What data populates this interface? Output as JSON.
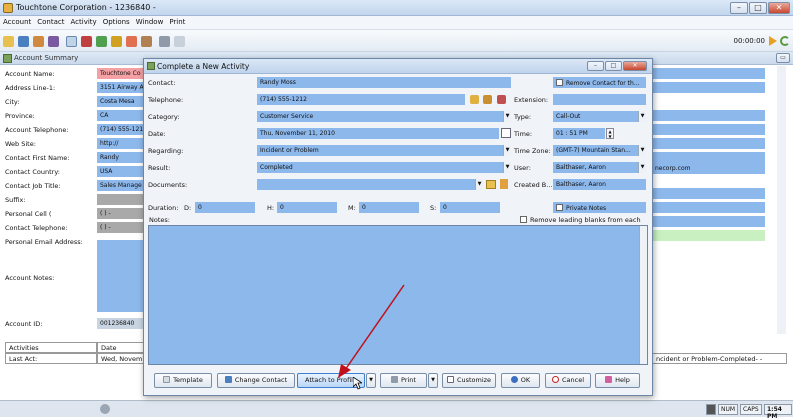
{
  "window": {
    "title": "Touchtone Corporation - 1236840 -"
  },
  "menu": [
    "Account",
    "Contact",
    "Activity",
    "Options",
    "Window",
    "Print"
  ],
  "toolbar": {
    "timer": "00:00:00"
  },
  "summary": {
    "title": "Account Summary",
    "fields": [
      {
        "label": "Account Name:",
        "value": "Touchtone Co"
      },
      {
        "label": "Address Line-1:",
        "value": "3151 Airway A"
      },
      {
        "label": "City:",
        "value": "Costa Mesa"
      },
      {
        "label": "Province:",
        "value": "CA"
      },
      {
        "label": "Account Telephone:",
        "value": "(714) 555-121"
      },
      {
        "label": "Web Site:",
        "value": "http://"
      },
      {
        "label": "Contact First Name:",
        "value": "Randy"
      },
      {
        "label": "Contact Country:",
        "value": "USA"
      },
      {
        "label": "Contact Job Title:",
        "value": "Sales Manage"
      },
      {
        "label": "Suffix:",
        "value": ""
      },
      {
        "label": "Personal Cell (",
        "value": "(  )  -"
      },
      {
        "label": "Contact Telephone:",
        "value": "(  )  -"
      },
      {
        "label": "Personal Email Address:",
        "value": ""
      }
    ],
    "notes_label": "Account Notes:",
    "id_label": "Account ID:",
    "id_value": "001236840",
    "right_email": "necorp.com",
    "grid": {
      "headers": [
        "Activities",
        "Date"
      ],
      "row_label": "Last Act:",
      "row_date": "Wed, Novembe",
      "row_tail": "ncident or Problem-Completed- -"
    }
  },
  "dialog": {
    "title": "Complete a New Activity",
    "contact_label": "Contact:",
    "contact_value": "Randy Moss",
    "remove_contact": "Remove Contact for th...",
    "telephone_label": "Telephone:",
    "telephone_value": "(714) 555-1212",
    "extension_label": "Extension:",
    "category_label": "Category:",
    "category_value": "Customer Service",
    "type_label": "Type:",
    "type_value": "Call-Out",
    "date_label": "Date:",
    "date_value": "Thu, November 11, 2010",
    "time_label": "Time:",
    "time_value": "01 : 51  PM",
    "regarding_label": "Regarding:",
    "regarding_value": "Incident or Problem",
    "timezone_label": "Time Zone:",
    "timezone_value": "(GMT-7) Mountain Stan...",
    "result_label": "Result:",
    "result_value": "Completed",
    "user_label": "User:",
    "user_value": "Balthaser, Aaron",
    "documents_label": "Documents:",
    "created_label": "Created B...",
    "created_value": "Balthaser, Aaron",
    "duration_label": "Duration:",
    "d_label": "D:",
    "d_value": "0",
    "h_label": "H:",
    "h_value": "0",
    "m_label": "M:",
    "m_value": "0",
    "s_label": "S:",
    "s_value": "0",
    "private_notes": "Private Notes",
    "notes_label": "Notes:",
    "remove_blanks": "Remove leading blanks from each line",
    "buttons": {
      "template": "Template",
      "change_contact": "Change Contact",
      "attach": "Attach to Profile",
      "print": "Print",
      "customize": "Customize",
      "ok": "OK",
      "cancel": "Cancel",
      "help": "Help"
    }
  },
  "status": {
    "num": "NUM",
    "caps": "CAPS",
    "time": "1:54 PM"
  },
  "colors": {
    "field_blue": "#8db8ec",
    "required_red": "#f4a0a4",
    "arrow_red": "#c0101a"
  }
}
